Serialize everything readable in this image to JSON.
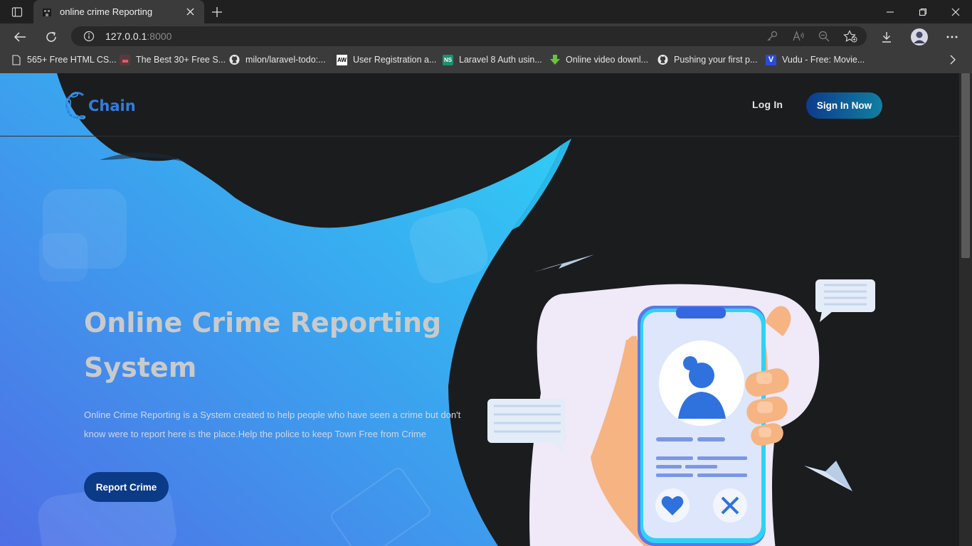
{
  "browser": {
    "tab_title": "online crime Reporting",
    "url_host": "127.0.0.1",
    "url_port": ":8000",
    "bookmarks": [
      {
        "label": "565+ Free HTML CS...",
        "icon": "page-icon"
      },
      {
        "label": "The Best 30+ Free S...",
        "icon": "site-icon"
      },
      {
        "label": "milon/laravel-todo:...",
        "icon": "github-icon"
      },
      {
        "label": "User Registration a...",
        "icon": "aw-icon"
      },
      {
        "label": "Laravel 8 Auth usin...",
        "icon": "ns-icon"
      },
      {
        "label": "Online video downl...",
        "icon": "download-arrow-icon"
      },
      {
        "label": "Pushing your first p...",
        "icon": "github-icon"
      },
      {
        "label": "Vudu - Free: Movie...",
        "icon": "vudu-icon"
      }
    ]
  },
  "site": {
    "brand": "Chain",
    "nav_login": "Log In",
    "nav_signin": "Sign In Now",
    "hero_title": "Online Crime Reporting System",
    "hero_description": "Online Crime Reporting is a System created to help people who have seen a crime but don't know were to report here is the place.Help the police to keep Town Free from Crime",
    "cta": "Report Crime"
  },
  "colors": {
    "accent_blue": "#2f7de1",
    "button_dark_blue": "#0b3a86",
    "hero_gradient_start": "#4f6fe6",
    "hero_gradient_end": "#2fd2f6",
    "page_background": "#1b1c1e"
  }
}
